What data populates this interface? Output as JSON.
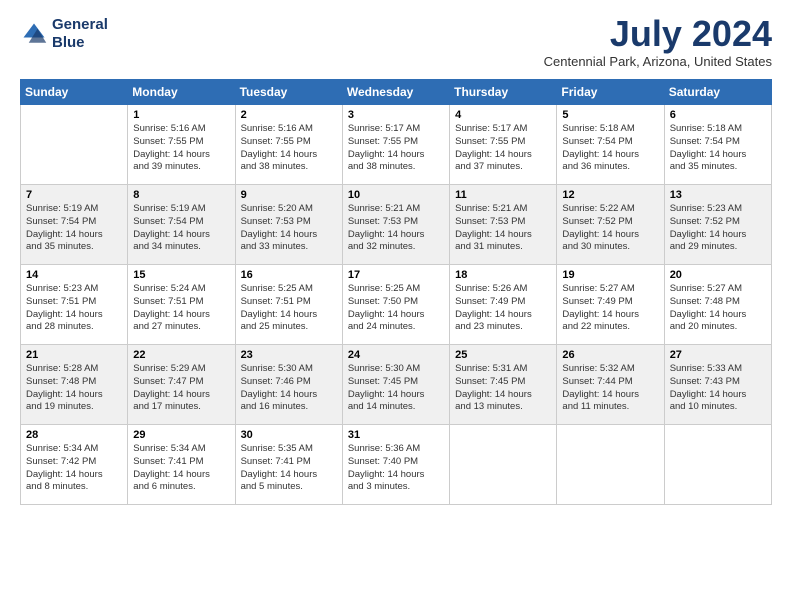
{
  "header": {
    "logo_line1": "General",
    "logo_line2": "Blue",
    "month_title": "July 2024",
    "location": "Centennial Park, Arizona, United States"
  },
  "days_of_week": [
    "Sunday",
    "Monday",
    "Tuesday",
    "Wednesday",
    "Thursday",
    "Friday",
    "Saturday"
  ],
  "weeks": [
    [
      {
        "day": "",
        "info": ""
      },
      {
        "day": "1",
        "info": "Sunrise: 5:16 AM\nSunset: 7:55 PM\nDaylight: 14 hours\nand 39 minutes."
      },
      {
        "day": "2",
        "info": "Sunrise: 5:16 AM\nSunset: 7:55 PM\nDaylight: 14 hours\nand 38 minutes."
      },
      {
        "day": "3",
        "info": "Sunrise: 5:17 AM\nSunset: 7:55 PM\nDaylight: 14 hours\nand 38 minutes."
      },
      {
        "day": "4",
        "info": "Sunrise: 5:17 AM\nSunset: 7:55 PM\nDaylight: 14 hours\nand 37 minutes."
      },
      {
        "day": "5",
        "info": "Sunrise: 5:18 AM\nSunset: 7:54 PM\nDaylight: 14 hours\nand 36 minutes."
      },
      {
        "day": "6",
        "info": "Sunrise: 5:18 AM\nSunset: 7:54 PM\nDaylight: 14 hours\nand 35 minutes."
      }
    ],
    [
      {
        "day": "7",
        "info": "Sunrise: 5:19 AM\nSunset: 7:54 PM\nDaylight: 14 hours\nand 35 minutes."
      },
      {
        "day": "8",
        "info": "Sunrise: 5:19 AM\nSunset: 7:54 PM\nDaylight: 14 hours\nand 34 minutes."
      },
      {
        "day": "9",
        "info": "Sunrise: 5:20 AM\nSunset: 7:53 PM\nDaylight: 14 hours\nand 33 minutes."
      },
      {
        "day": "10",
        "info": "Sunrise: 5:21 AM\nSunset: 7:53 PM\nDaylight: 14 hours\nand 32 minutes."
      },
      {
        "day": "11",
        "info": "Sunrise: 5:21 AM\nSunset: 7:53 PM\nDaylight: 14 hours\nand 31 minutes."
      },
      {
        "day": "12",
        "info": "Sunrise: 5:22 AM\nSunset: 7:52 PM\nDaylight: 14 hours\nand 30 minutes."
      },
      {
        "day": "13",
        "info": "Sunrise: 5:23 AM\nSunset: 7:52 PM\nDaylight: 14 hours\nand 29 minutes."
      }
    ],
    [
      {
        "day": "14",
        "info": "Sunrise: 5:23 AM\nSunset: 7:51 PM\nDaylight: 14 hours\nand 28 minutes."
      },
      {
        "day": "15",
        "info": "Sunrise: 5:24 AM\nSunset: 7:51 PM\nDaylight: 14 hours\nand 27 minutes."
      },
      {
        "day": "16",
        "info": "Sunrise: 5:25 AM\nSunset: 7:51 PM\nDaylight: 14 hours\nand 25 minutes."
      },
      {
        "day": "17",
        "info": "Sunrise: 5:25 AM\nSunset: 7:50 PM\nDaylight: 14 hours\nand 24 minutes."
      },
      {
        "day": "18",
        "info": "Sunrise: 5:26 AM\nSunset: 7:49 PM\nDaylight: 14 hours\nand 23 minutes."
      },
      {
        "day": "19",
        "info": "Sunrise: 5:27 AM\nSunset: 7:49 PM\nDaylight: 14 hours\nand 22 minutes."
      },
      {
        "day": "20",
        "info": "Sunrise: 5:27 AM\nSunset: 7:48 PM\nDaylight: 14 hours\nand 20 minutes."
      }
    ],
    [
      {
        "day": "21",
        "info": "Sunrise: 5:28 AM\nSunset: 7:48 PM\nDaylight: 14 hours\nand 19 minutes."
      },
      {
        "day": "22",
        "info": "Sunrise: 5:29 AM\nSunset: 7:47 PM\nDaylight: 14 hours\nand 17 minutes."
      },
      {
        "day": "23",
        "info": "Sunrise: 5:30 AM\nSunset: 7:46 PM\nDaylight: 14 hours\nand 16 minutes."
      },
      {
        "day": "24",
        "info": "Sunrise: 5:30 AM\nSunset: 7:45 PM\nDaylight: 14 hours\nand 14 minutes."
      },
      {
        "day": "25",
        "info": "Sunrise: 5:31 AM\nSunset: 7:45 PM\nDaylight: 14 hours\nand 13 minutes."
      },
      {
        "day": "26",
        "info": "Sunrise: 5:32 AM\nSunset: 7:44 PM\nDaylight: 14 hours\nand 11 minutes."
      },
      {
        "day": "27",
        "info": "Sunrise: 5:33 AM\nSunset: 7:43 PM\nDaylight: 14 hours\nand 10 minutes."
      }
    ],
    [
      {
        "day": "28",
        "info": "Sunrise: 5:34 AM\nSunset: 7:42 PM\nDaylight: 14 hours\nand 8 minutes."
      },
      {
        "day": "29",
        "info": "Sunrise: 5:34 AM\nSunset: 7:41 PM\nDaylight: 14 hours\nand 6 minutes."
      },
      {
        "day": "30",
        "info": "Sunrise: 5:35 AM\nSunset: 7:41 PM\nDaylight: 14 hours\nand 5 minutes."
      },
      {
        "day": "31",
        "info": "Sunrise: 5:36 AM\nSunset: 7:40 PM\nDaylight: 14 hours\nand 3 minutes."
      },
      {
        "day": "",
        "info": ""
      },
      {
        "day": "",
        "info": ""
      },
      {
        "day": "",
        "info": ""
      }
    ]
  ]
}
